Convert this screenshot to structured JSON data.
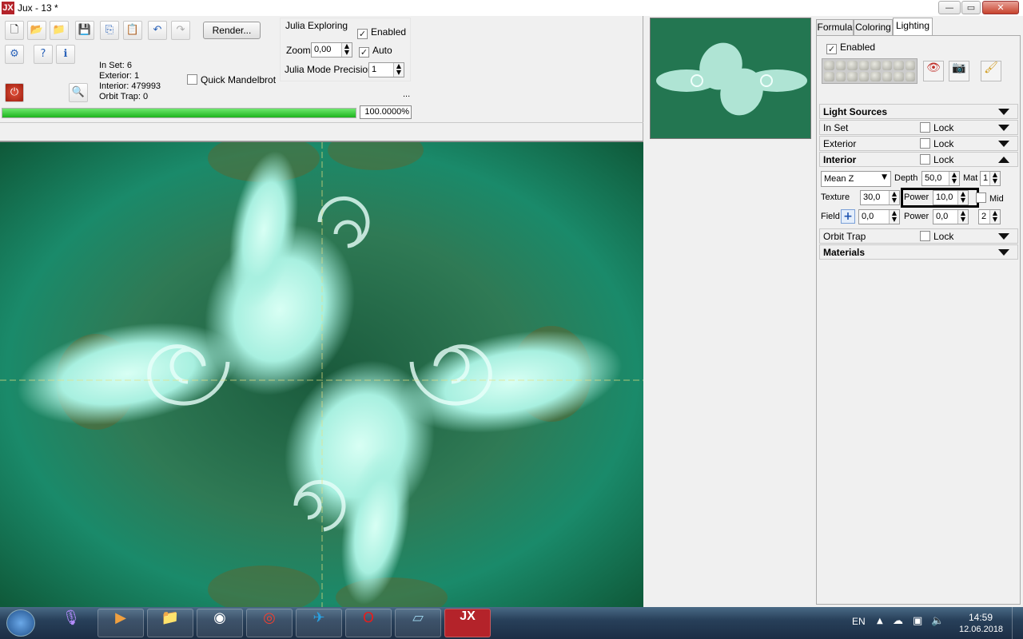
{
  "window": {
    "title": "Jux - 13 *",
    "logo": "JX",
    "controls": [
      "minimize",
      "maximize",
      "close"
    ]
  },
  "toolbar": {
    "render_label": "Render...",
    "stats": {
      "in_set": "In Set: 6",
      "exterior": "Exterior: 1",
      "interior": "Interior: 479993",
      "orbit_trap": "Orbit Trap: 0"
    },
    "quick_mandelbrot": "Quick Mandelbrot",
    "julia": {
      "title": "Julia Exploring",
      "enabled_label": "Enabled",
      "zoom_label": "Zoom",
      "zoom_value": "0,00",
      "auto_label": "Auto",
      "precision_label": "Julia Mode Precision",
      "precision_value": "1",
      "ellipsis": "..."
    },
    "progress": {
      "value": 1.0,
      "text": "100.0000%"
    }
  },
  "panel": {
    "tabs": [
      "Formula",
      "Coloring",
      "Lighting"
    ],
    "active_tab": "Lighting",
    "enabled_label": "Enabled",
    "sections": {
      "light_sources": "Light Sources",
      "in_set": "In Set",
      "exterior": "Exterior",
      "interior": "Interior",
      "orbit_trap": "Orbit Trap",
      "materials": "Materials",
      "lock": "Lock"
    },
    "interior": {
      "mode": "Mean Z",
      "depth_label": "Depth",
      "depth_value": "50,0",
      "mat_label": "Mat",
      "mat_value": "1",
      "texture_label": "Texture",
      "texture_value": "30,0",
      "power_label": "Power",
      "power_value": "10,0",
      "mid_label": "Mid",
      "field_label": "Field",
      "field_value": "0,0",
      "power2_label": "Power",
      "power2_value": "0,0",
      "last_value": "2"
    }
  },
  "taskbar": {
    "apps": [
      "start-orb",
      "voice-assistant",
      "media-player",
      "file-explorer",
      "panda-app",
      "chrome",
      "telegram",
      "opera",
      "notepad",
      "jux"
    ],
    "lang": "EN",
    "time": "14:59",
    "date": "12.06.2018"
  },
  "colors": {
    "accent_green": "#1db41d",
    "highlight_box": "#000000",
    "fractal_bg": "#0d4a2e"
  }
}
